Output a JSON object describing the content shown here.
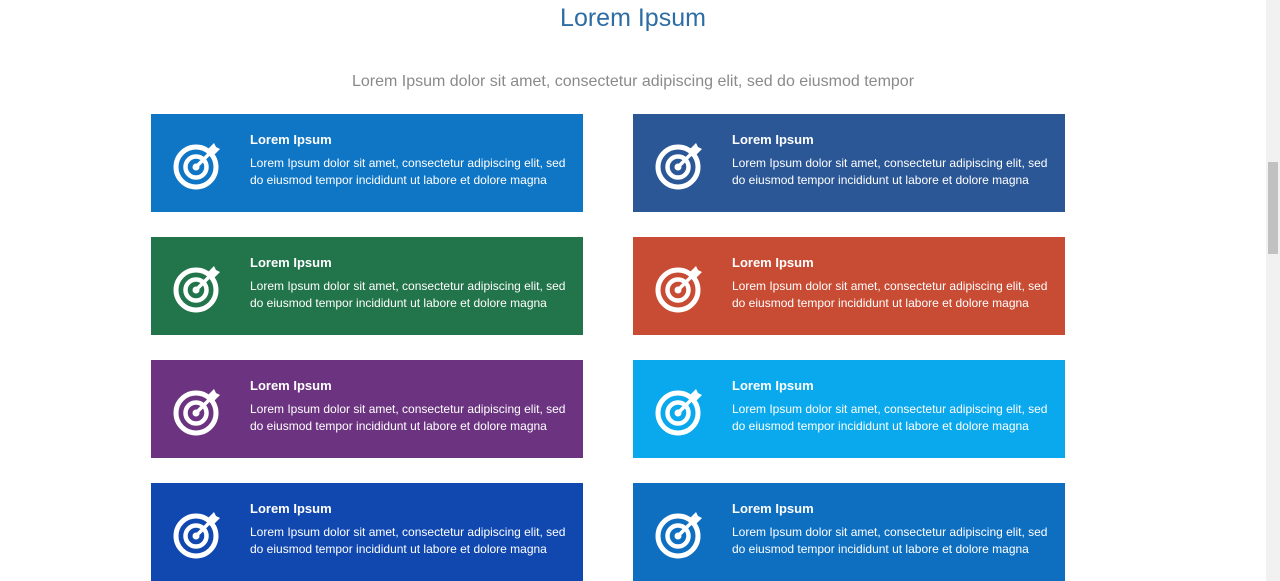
{
  "page": {
    "title": "Lorem Ipsum",
    "subtitle": "Lorem Ipsum dolor sit amet, consectetur adipiscing elit, sed do eiusmod tempor"
  },
  "cards": [
    {
      "title": "Lorem Ipsum",
      "body": "Lorem Ipsum dolor sit amet, consectetur adipiscing elit, sed do eiusmod tempor incididunt ut labore et dolore magna",
      "color": "#0f76c5",
      "icon": "target-arrow-icon"
    },
    {
      "title": "Lorem Ipsum",
      "body": "Lorem Ipsum dolor sit amet, consectetur adipiscing elit, sed do eiusmod tempor incididunt ut labore et dolore magna",
      "color": "#2b5796",
      "icon": "target-arrow-icon"
    },
    {
      "title": "Lorem Ipsum",
      "body": "Lorem Ipsum dolor sit amet, consectetur adipiscing elit, sed do eiusmod tempor incididunt ut labore et dolore magna",
      "color": "#22744a",
      "icon": "target-arrow-icon"
    },
    {
      "title": "Lorem Ipsum",
      "body": "Lorem Ipsum dolor sit amet, consectetur adipiscing elit, sed do eiusmod tempor incididunt ut labore et dolore magna",
      "color": "#c84b33",
      "icon": "target-arrow-icon"
    },
    {
      "title": "Lorem Ipsum",
      "body": "Lorem Ipsum dolor sit amet, consectetur adipiscing elit, sed do eiusmod tempor incididunt ut labore et dolore magna",
      "color": "#6c3480",
      "icon": "target-arrow-icon"
    },
    {
      "title": "Lorem Ipsum",
      "body": "Lorem Ipsum dolor sit amet, consectetur adipiscing elit, sed do eiusmod tempor incididunt ut labore et dolore magna",
      "color": "#0aa9ee",
      "icon": "target-arrow-icon"
    },
    {
      "title": "Lorem Ipsum",
      "body": "Lorem Ipsum dolor sit amet, consectetur adipiscing elit, sed do eiusmod tempor incididunt ut labore et dolore magna",
      "color": "#1048b0",
      "icon": "target-arrow-icon"
    },
    {
      "title": "Lorem Ipsum",
      "body": "Lorem Ipsum dolor sit amet, consectetur adipiscing elit, sed do eiusmod tempor incididunt ut labore et dolore magna",
      "color": "#0e6fc1",
      "icon": "target-arrow-icon"
    }
  ]
}
